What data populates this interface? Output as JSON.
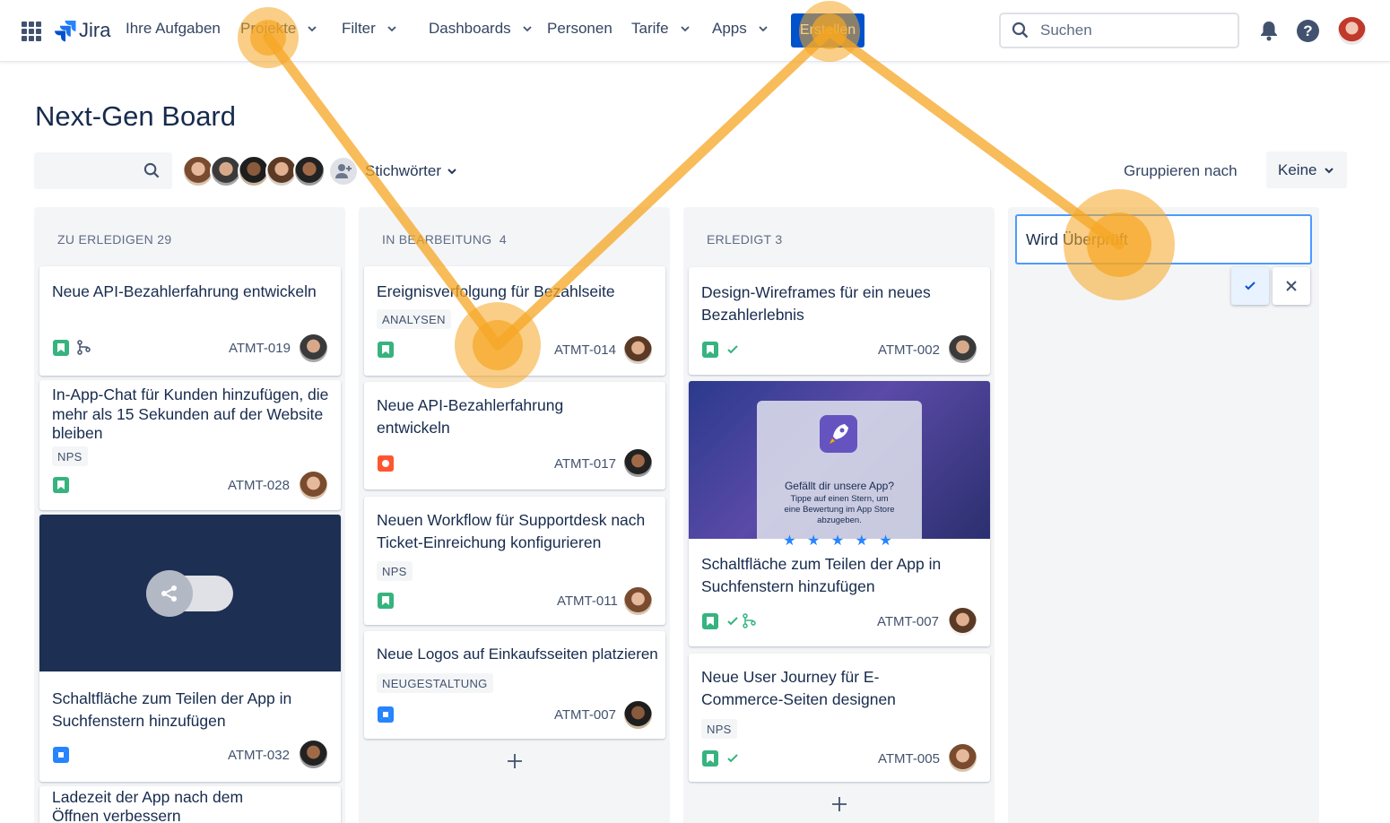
{
  "nav": {
    "app_name": "Jira",
    "items": [
      {
        "label": "Ihre Aufgaben",
        "dropdown": false
      },
      {
        "label": "Projekte",
        "dropdown": true
      },
      {
        "label": "Filter",
        "dropdown": true
      },
      {
        "label": "Dashboards",
        "dropdown": true
      },
      {
        "label": "Personen",
        "dropdown": false
      },
      {
        "label": "Tarife",
        "dropdown": true
      },
      {
        "label": "Apps",
        "dropdown": true
      }
    ],
    "create_label": "Erstellen",
    "search_placeholder": "Suchen"
  },
  "board": {
    "title": "Next-Gen Board",
    "tags_label": "Stichwörter",
    "group_by_label": "Gruppieren nach",
    "group_by_value": "Keine"
  },
  "columns": [
    {
      "header": "ZU ERLEDIGEN 29",
      "cards": [
        {
          "title": "Neue API-Bezahlerfahrung entwickeln",
          "key": "ATMT-019",
          "type": "story"
        },
        {
          "title": "In-App-Chat für Kunden hinzufügen, die mehr als 15 Sekunden auf der Website bleiben",
          "label": "NPS",
          "key": "ATMT-028",
          "type": "story"
        },
        {
          "title": "Schaltfläche zum Teilen der App in Suchfenstern hinzufügen",
          "key": "ATMT-032",
          "type": "task"
        },
        {
          "title": "Ladezeit der App nach dem Öffnen verbessern"
        }
      ]
    },
    {
      "header": "IN BEARBEITUNG  4",
      "cards": [
        {
          "title": "Ereignisverfolgung für Bezahlseite",
          "label": "ANALYSEN",
          "key": "ATMT-014",
          "type": "story"
        },
        {
          "title": "Neue API-Bezahlerfahrung entwickeln",
          "key": "ATMT-017",
          "type": "bug"
        },
        {
          "title": "Neuen Workflow für Supportdesk nach Ticket-Einreichung konfigurieren",
          "label": "NPS",
          "key": "ATMT-011",
          "type": "story"
        },
        {
          "title": "Neue Logos auf Einkaufsseiten platzieren",
          "label": "NEUGESTALTUNG",
          "key": "ATMT-007",
          "type": "task"
        }
      ]
    },
    {
      "header": "ERLEDIGT 3",
      "cards": [
        {
          "title": "Design-Wireframes für ein neues Bezahlerlebnis",
          "key": "ATMT-002",
          "type": "story"
        },
        {
          "title": "Schaltfläche zum Teilen der App in Suchfenstern hinzufügen",
          "key": "ATMT-007",
          "type": "story",
          "cover": {
            "heading": "Gefällt dir unsere App?",
            "text": "Tippe auf einen Stern, um eine Bewertung im App Store abzugeben.",
            "stars": "★ ★ ★ ★ ★"
          }
        },
        {
          "title": "Neue User Journey für E-Commerce-Seiten designen",
          "label": "NPS",
          "key": "ATMT-005",
          "type": "story"
        }
      ]
    }
  ],
  "new_column": {
    "value": "Wird Überprüft"
  },
  "colors": {
    "accent": "#0052cc",
    "highlight": "#f5a623",
    "story": "#36b37e",
    "task": "#2684ff",
    "bug": "#ff5630"
  },
  "icons": [
    "app-switcher-icon",
    "jira-logo-icon",
    "chevron-down-icon",
    "search-icon",
    "bell-icon",
    "help-icon",
    "story-icon",
    "task-icon",
    "bug-icon",
    "done-check-icon",
    "branch-icon",
    "add-icon",
    "confirm-icon",
    "close-icon",
    "share-icon",
    "rocket-icon"
  ]
}
